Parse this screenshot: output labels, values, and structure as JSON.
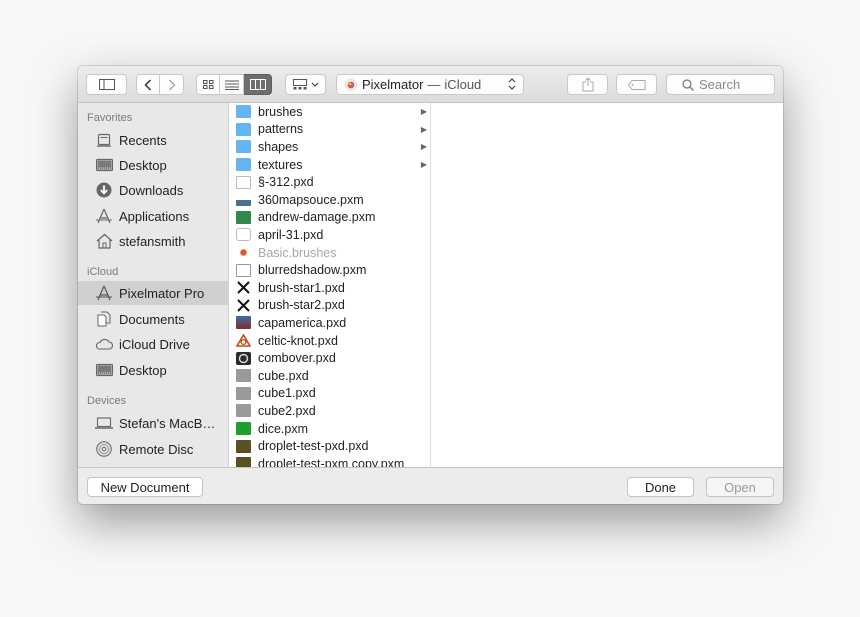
{
  "window": {
    "path_app": "Pixelmator",
    "path_sep": "—",
    "path_location": "iCloud",
    "search_placeholder": "Search"
  },
  "sidebar": {
    "favorites_label": "Favorites",
    "favorites": [
      {
        "label": "Recents",
        "icon": "recents-icon"
      },
      {
        "label": "Desktop",
        "icon": "desktop-folder-icon"
      },
      {
        "label": "Downloads",
        "icon": "downloads-icon"
      },
      {
        "label": "Applications",
        "icon": "applications-icon"
      },
      {
        "label": "stefansmith",
        "icon": "home-icon"
      }
    ],
    "icloud_label": "iCloud",
    "icloud": [
      {
        "label": "Pixelmator Pro",
        "icon": "applications-icon",
        "selected": true
      },
      {
        "label": "Documents",
        "icon": "documents-icon"
      },
      {
        "label": "iCloud Drive",
        "icon": "cloud-icon"
      },
      {
        "label": "Desktop",
        "icon": "desktop-folder-icon"
      }
    ],
    "devices_label": "Devices",
    "devices": [
      {
        "label": "Stefan's MacB…",
        "icon": "laptop-icon"
      },
      {
        "label": "Remote Disc",
        "icon": "disc-icon"
      }
    ]
  },
  "files": [
    {
      "name": "brushes",
      "kind": "folder",
      "arrow": "▶"
    },
    {
      "name": "patterns",
      "kind": "folder",
      "arrow": "▶"
    },
    {
      "name": "shapes",
      "kind": "folder",
      "arrow": "▶"
    },
    {
      "name": "textures",
      "kind": "folder",
      "arrow": "▶"
    },
    {
      "name": "§-312.pxd",
      "kind": "blank"
    },
    {
      "name": "360mapsouce.pxm",
      "kind": "map"
    },
    {
      "name": "andrew-damage.pxm",
      "kind": "green-doc"
    },
    {
      "name": "april-31.pxd",
      "kind": "blank-wide"
    },
    {
      "name": "Basic.brushes",
      "kind": "brushes",
      "dim": true
    },
    {
      "name": "blurredshadow.pxm",
      "kind": "shadow"
    },
    {
      "name": "brush-star1.pxd",
      "kind": "cross"
    },
    {
      "name": "brush-star2.pxd",
      "kind": "cross"
    },
    {
      "name": "capamerica.pxd",
      "kind": "figure"
    },
    {
      "name": "celtic-knot.pxd",
      "kind": "knot"
    },
    {
      "name": "combover.pxd",
      "kind": "dark"
    },
    {
      "name": "cube.pxd",
      "kind": "grey"
    },
    {
      "name": "cube1.pxd",
      "kind": "grey"
    },
    {
      "name": "cube2.pxd",
      "kind": "grey"
    },
    {
      "name": "dice.pxm",
      "kind": "green"
    },
    {
      "name": "droplet-test-pxd.pxd",
      "kind": "olive"
    },
    {
      "name": "droplet-test-pxm copy.pxm",
      "kind": "olive"
    }
  ],
  "bottom": {
    "new_document": "New Document",
    "done": "Done",
    "open": "Open"
  },
  "colors": {
    "folder": "#64b5f0",
    "selected_sidebar": "#d0d0d0"
  }
}
